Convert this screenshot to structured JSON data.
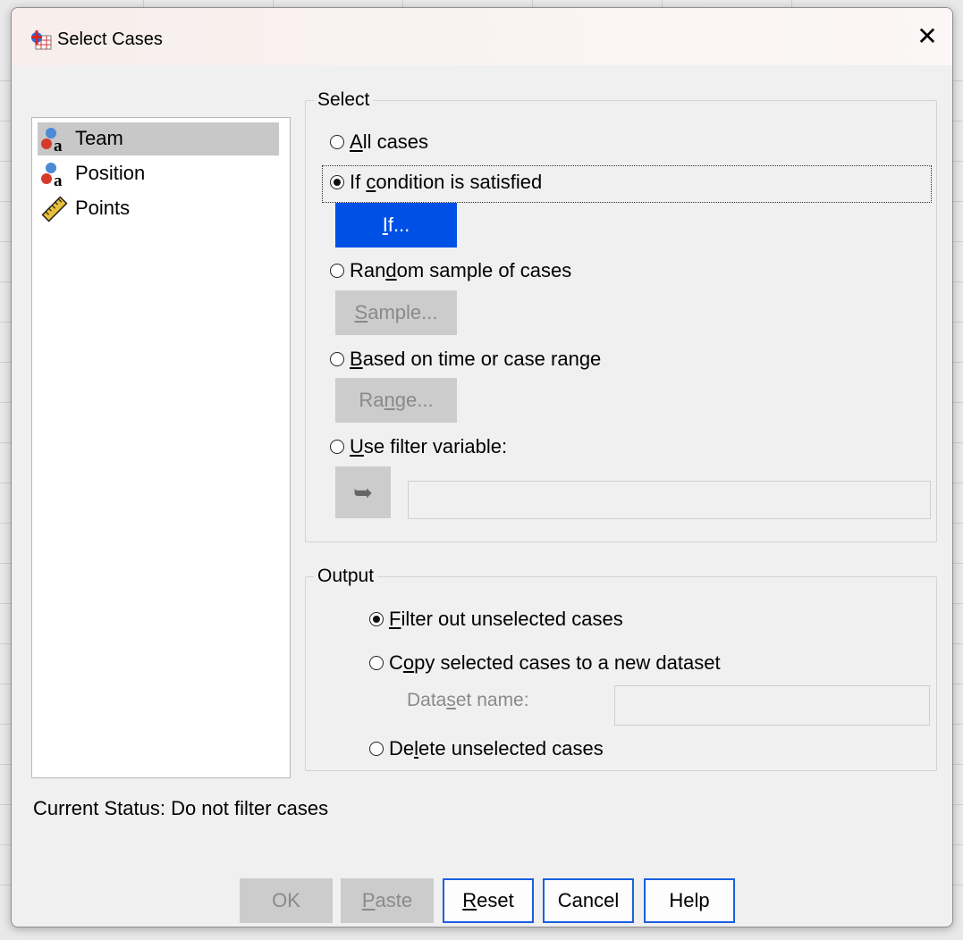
{
  "window": {
    "title": "Select Cases",
    "close_glyph": "✕",
    "icon": "spss-select-cases-icon"
  },
  "variables": [
    {
      "label": "Team",
      "icon": "nominal-variable-icon",
      "selected": true
    },
    {
      "label": "Position",
      "icon": "nominal-variable-icon",
      "selected": false
    },
    {
      "label": "Points",
      "icon": "scale-variable-icon",
      "selected": false
    }
  ],
  "select_group": {
    "legend": "Select",
    "all_cases": {
      "pre": "",
      "key": "A",
      "post": "ll cases",
      "checked": false
    },
    "if_condition": {
      "pre": "If ",
      "key": "c",
      "post": "ondition is satisfied",
      "checked": true
    },
    "if_button": {
      "pre": "",
      "key": "I",
      "post": "f..."
    },
    "random_sample": {
      "pre": "Ran",
      "key": "d",
      "post": "om sample of cases",
      "checked": false
    },
    "sample_button": {
      "pre": "",
      "key": "S",
      "post": "ample..."
    },
    "time_range": {
      "pre": "",
      "key": "B",
      "post": "ased on time or case range",
      "checked": false
    },
    "range_button": {
      "pre": "Ra",
      "key": "n",
      "post": "ge..."
    },
    "filter_variable": {
      "pre": "",
      "key": "U",
      "post": "se filter variable:",
      "checked": false
    },
    "arrow_glyph": "➥",
    "filter_field_value": ""
  },
  "output_group": {
    "legend": "Output",
    "filter_out": {
      "pre": "",
      "key": "F",
      "post": "ilter out unselected cases",
      "checked": true
    },
    "copy_new": {
      "pre": "C",
      "key": "o",
      "post": "py selected cases to a new dataset",
      "checked": false
    },
    "dataset_name": {
      "pre": "Data",
      "key": "s",
      "post": "et name:",
      "value": ""
    },
    "delete": {
      "pre": "De",
      "key": "l",
      "post": "ete unselected cases",
      "checked": false
    }
  },
  "status": "Current Status: Do not filter cases",
  "buttons": {
    "ok": {
      "pre": "OK",
      "key": "",
      "post": ""
    },
    "paste": {
      "pre": "",
      "key": "P",
      "post": "aste"
    },
    "reset": {
      "pre": "",
      "key": "R",
      "post": "eset"
    },
    "cancel": {
      "pre": "Cancel",
      "key": "",
      "post": ""
    },
    "help": {
      "pre": "Help",
      "key": "",
      "post": ""
    }
  },
  "colors": {
    "accent": "#0050e6",
    "button_border": "#1a5fe0",
    "disabled": "#cccccc"
  }
}
